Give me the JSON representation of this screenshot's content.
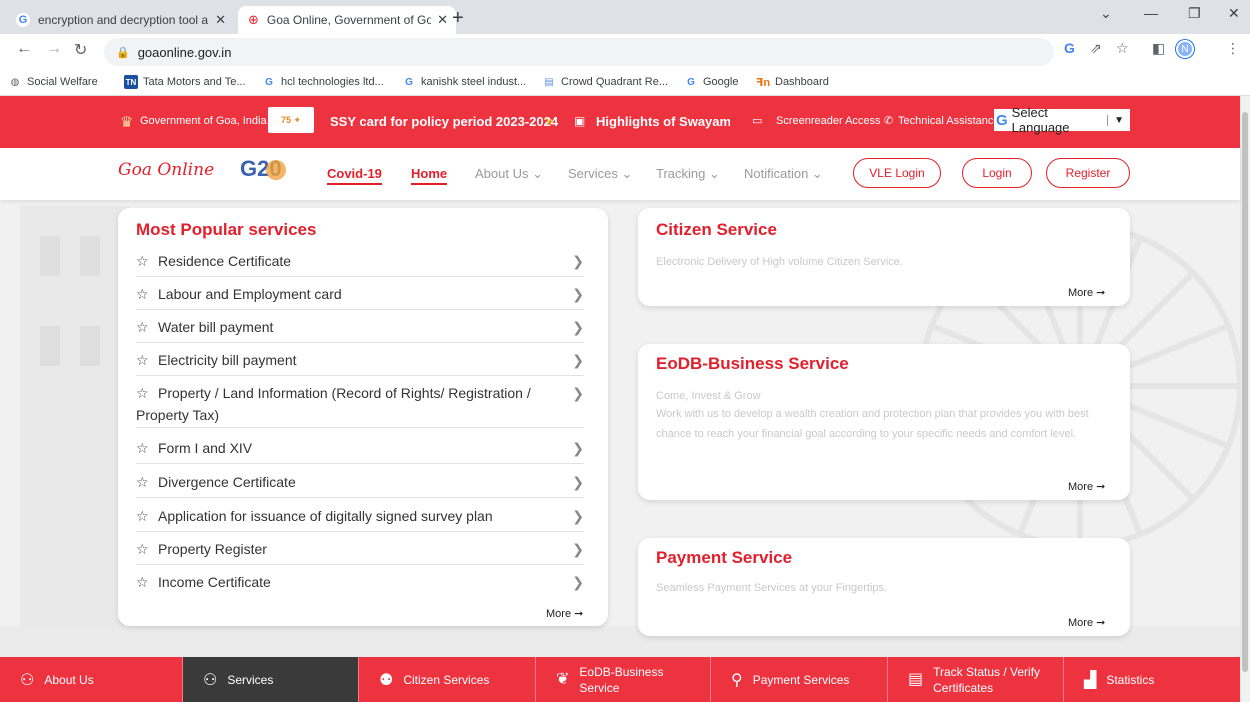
{
  "browser": {
    "tabs": [
      {
        "title": "encryption and decryption tool a",
        "active": false
      },
      {
        "title": "Goa Online, Government of Goa,",
        "active": true
      }
    ],
    "url": "goaonline.gov.in",
    "profile_initial": "N",
    "bookmarks": [
      "Social Welfare",
      "Tata Motors and Te...",
      "hcl technologies ltd...",
      "kanishk steel indust...",
      "Crowd Quadrant Re...",
      "Google",
      "Dashboard"
    ]
  },
  "topbar": {
    "gov_text": "Government of Goa, India",
    "ticker": "SSY card for policy period 2023-2024",
    "ticker2": "Highlights of Swayamp",
    "screenreader": "Screenreader Access",
    "tech": "Technical Assistance",
    "language": "Select Language"
  },
  "header": {
    "logo": "Goa Online",
    "g20": "G20",
    "nav": [
      "Covid-19",
      "Home",
      "About Us",
      "Services",
      "Tracking",
      "Notification"
    ],
    "buttons": [
      "VLE Login",
      "Login",
      "Register"
    ]
  },
  "popular": {
    "title": "Most Popular services",
    "items": [
      "Residence Certificate",
      "Labour and Employment card",
      "Water bill payment",
      "Electricity bill payment",
      "Property / Land Information (Record of Rights/ Registration / Property Tax)",
      "Form I and XIV",
      "Divergence Certificate",
      "Application for issuance of digitally signed survey plan",
      "Property Register",
      "Income Certificate"
    ],
    "more": "More"
  },
  "citizen": {
    "title": "Citizen Service",
    "desc": "Electronic Delivery of High volume Citizen Service.",
    "more": "More"
  },
  "eodb": {
    "title": "EoDB-Business Service",
    "sub": "Come, Invest & Grow",
    "desc": "Work with us to develop a wealth creation and protection plan that provides you with best chance to reach your financial goal according to your specific needs and comfort level.",
    "more": "More"
  },
  "payment": {
    "title": "Payment Service",
    "desc": "Seamless Payment Services at your Fingertips.",
    "more": "More"
  },
  "footer": [
    "About Us",
    "Services",
    "Citizen Services",
    "EoDB-Business Service",
    "Payment Services",
    "Track Status / Verify Certificates",
    "Statistics"
  ],
  "colors": {
    "brand": "#ee3340",
    "accent": "#e21f2b"
  }
}
